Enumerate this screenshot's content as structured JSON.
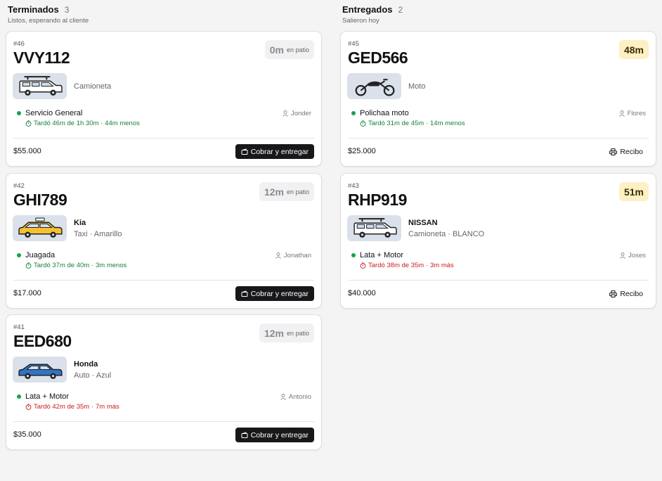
{
  "columns": {
    "terminados": {
      "title": "Terminados",
      "count": "3",
      "subtitle": "Listos, esperando al cliente",
      "cards": [
        {
          "ticket": "#46",
          "plate": "VVY112",
          "timer_value": "0m",
          "timer_unit": "en patio",
          "vehicle_name": "",
          "vehicle_desc": "Camioneta",
          "vehicle_icon": "suv-icon",
          "service": "Servicio General",
          "time_text": "Tardó 46m de 1h 30m · ",
          "time_diff": "44m menos",
          "worker": "Jonder",
          "price": "$55.000",
          "action": "Cobrar y entregar"
        },
        {
          "ticket": "#42",
          "plate": "GHI789",
          "timer_value": "12m",
          "timer_unit": "en patio",
          "vehicle_name": "Kia",
          "vehicle_desc": "Taxi · Amarillo",
          "vehicle_icon": "taxi-icon",
          "service": "Juagada",
          "time_text": "Tardó 37m de 40m · ",
          "time_diff": "3m menos",
          "worker": "Jonathan",
          "price": "$17.000",
          "action": "Cobrar y entregar"
        },
        {
          "ticket": "#41",
          "plate": "EED680",
          "timer_value": "12m",
          "timer_unit": "en patio",
          "vehicle_name": "Honda",
          "vehicle_desc": "Auto · Azul",
          "vehicle_icon": "sedan-icon",
          "service": "Lata + Motor",
          "time_text": "Tardó 42m de 35m · ",
          "time_diff": "7m más",
          "worker": "Antonio",
          "price": "$35.000",
          "action": "Cobrar y entregar"
        }
      ]
    },
    "entregados": {
      "title": "Entregados",
      "count": "2",
      "subtitle": "Salieron hoy",
      "cards": [
        {
          "ticket": "#45",
          "plate": "GED566",
          "timer_value": "48m",
          "vehicle_name": "",
          "vehicle_desc": "Moto",
          "vehicle_icon": "motorcycle-icon",
          "service": "Polichaa moto",
          "time_text": "Tardó 31m de 45m · ",
          "time_diff": "14m menos",
          "worker": "Flores",
          "price": "$25.000",
          "action": "Recibo"
        },
        {
          "ticket": "#43",
          "plate": "RHP919",
          "timer_value": "51m",
          "vehicle_name": "NISSAN",
          "vehicle_desc": "Camioneta · BLANCO",
          "vehicle_icon": "suv-icon",
          "service": "Lata + Motor",
          "time_text": "Tardó 38m de 35m · ",
          "time_diff": "3m más",
          "worker": "Joses",
          "price": "$40.000",
          "action": "Recibo"
        }
      ]
    }
  },
  "colors": {
    "good": "#15803d",
    "bad": "#c81e1e",
    "taxi": "#f5c033",
    "sedan": "#2f74c9",
    "amber_badge": "#fdf0c4"
  }
}
